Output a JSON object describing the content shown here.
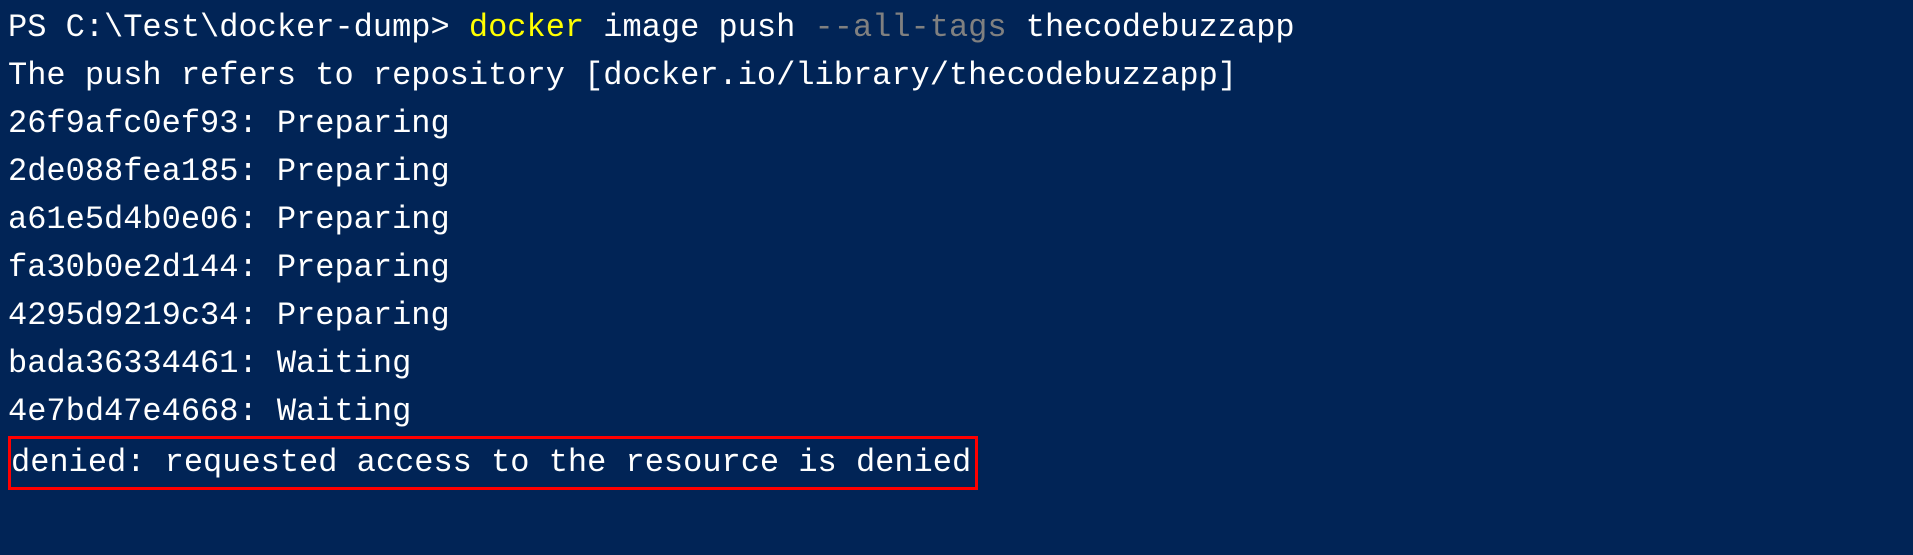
{
  "prompt": {
    "prefix": "PS C:\\Test\\docker-dump> ",
    "command": "docker",
    "args1": " image push ",
    "flag": "--all-tags",
    "args2": " thecodebuzzapp"
  },
  "output": {
    "line1": "The push refers to repository [docker.io/library/thecodebuzzapp]",
    "layers": [
      {
        "hash": "26f9afc0ef93",
        "status": "Preparing"
      },
      {
        "hash": "2de088fea185",
        "status": "Preparing"
      },
      {
        "hash": "a61e5d4b0e06",
        "status": "Preparing"
      },
      {
        "hash": "fa30b0e2d144",
        "status": "Preparing"
      },
      {
        "hash": "4295d9219c34",
        "status": "Preparing"
      },
      {
        "hash": "bada36334461",
        "status": "Waiting"
      },
      {
        "hash": "4e7bd47e4668",
        "status": "Waiting"
      }
    ],
    "error": "denied: requested access to the resource is denied"
  }
}
